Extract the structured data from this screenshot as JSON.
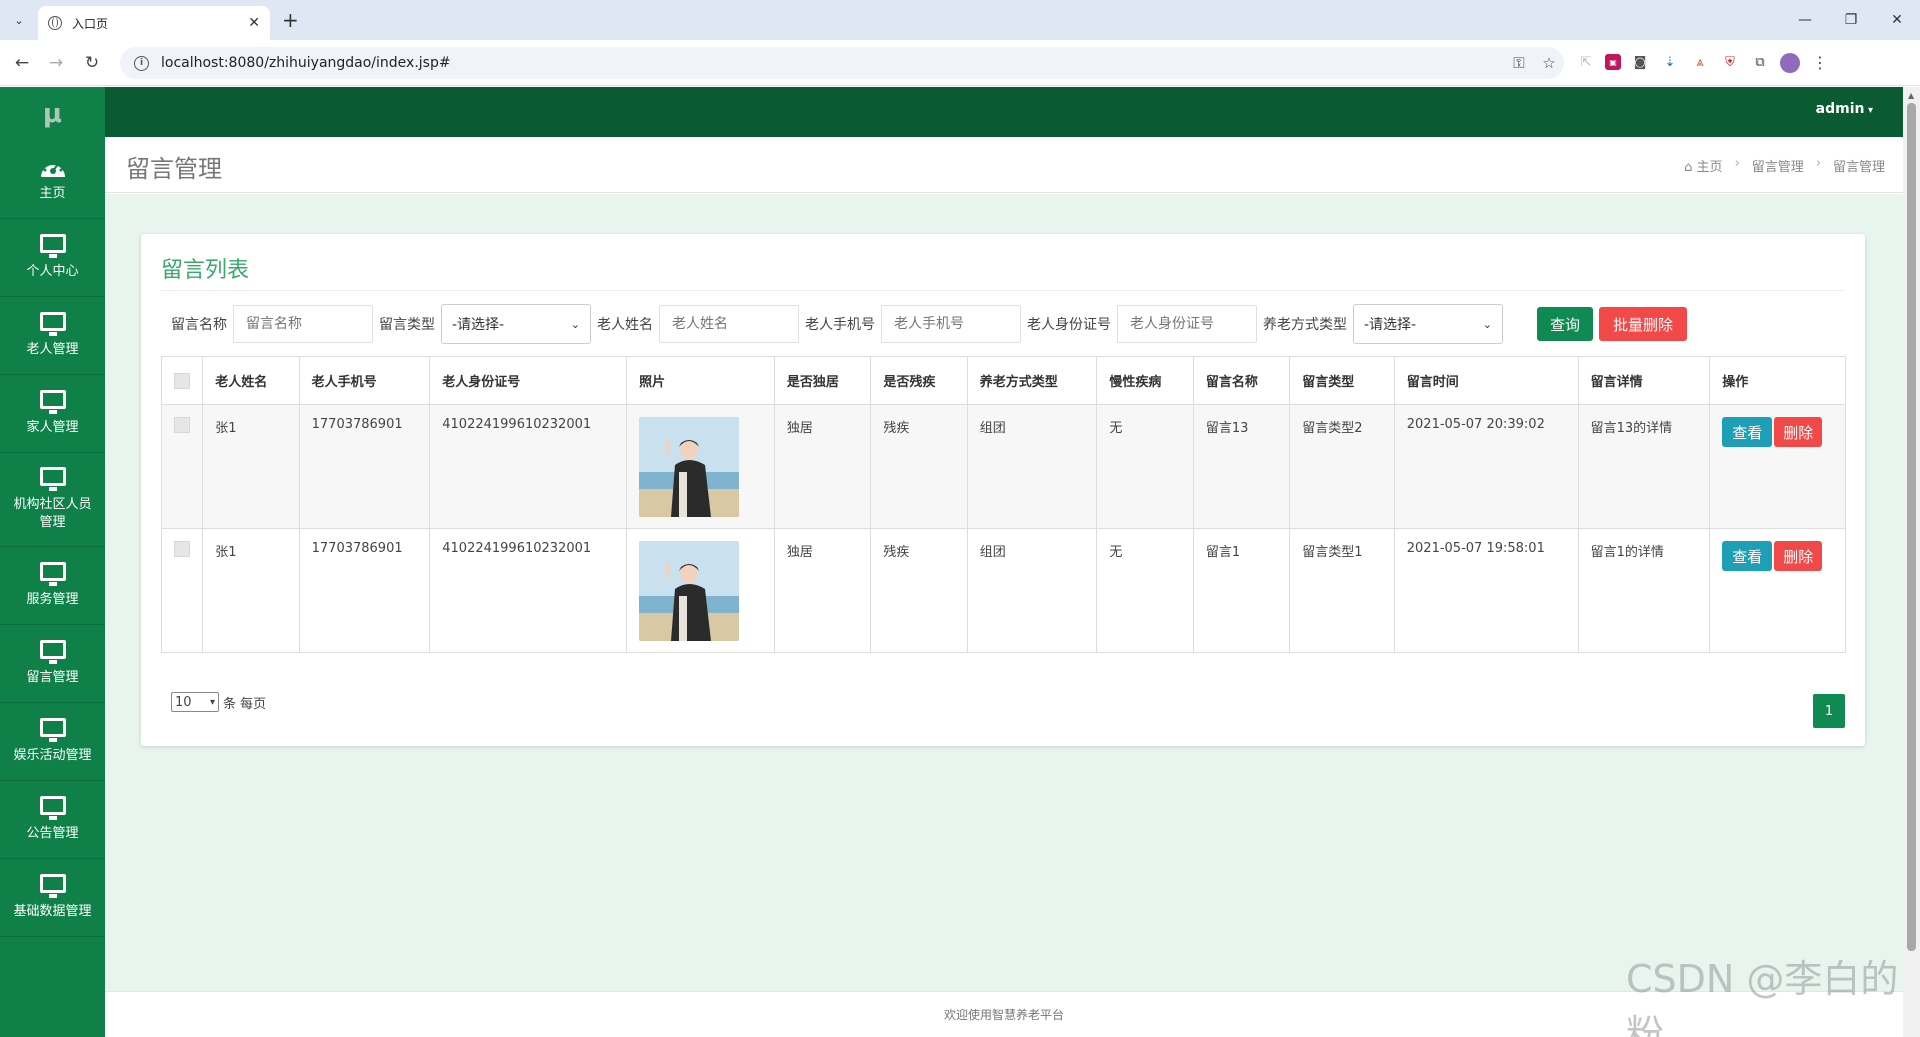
{
  "browser": {
    "tab_title": "入口页",
    "url": "localhost:8080/zhihuiyangdao/index.jsp#"
  },
  "sidebar": {
    "logo": "μ",
    "items": [
      {
        "label": "主页",
        "icon": "dashboard-icon"
      },
      {
        "label": "个人中心",
        "icon": "monitor-icon"
      },
      {
        "label": "老人管理",
        "icon": "monitor-icon"
      },
      {
        "label": "家人管理",
        "icon": "monitor-icon"
      },
      {
        "label": "机构社区人员管理",
        "icon": "monitor-icon"
      },
      {
        "label": "服务管理",
        "icon": "monitor-icon"
      },
      {
        "label": "留言管理",
        "icon": "monitor-icon"
      },
      {
        "label": "娱乐活动管理",
        "icon": "monitor-icon"
      },
      {
        "label": "公告管理",
        "icon": "monitor-icon"
      },
      {
        "label": "基础数据管理",
        "icon": "monitor-icon"
      }
    ]
  },
  "topbar": {
    "user": "admin"
  },
  "header": {
    "title": "留言管理",
    "breadcrumb": [
      "主页",
      "留言管理",
      "留言管理"
    ]
  },
  "card": {
    "title": "留言列表"
  },
  "filters": {
    "msg_name_label": "留言名称",
    "msg_name_placeholder": "留言名称",
    "msg_type_label": "留言类型",
    "msg_type_value": "-请选择-",
    "elder_name_label": "老人姓名",
    "elder_name_placeholder": "老人姓名",
    "elder_phone_label": "老人手机号",
    "elder_phone_placeholder": "老人手机号",
    "elder_id_label": "老人身份证号",
    "elder_id_placeholder": "老人身份证号",
    "care_type_label": "养老方式类型",
    "care_type_value": "-请选择-",
    "search_label": "查询",
    "batch_delete_label": "批量删除"
  },
  "table": {
    "headers": [
      "老人姓名",
      "老人手机号",
      "老人身份证号",
      "照片",
      "是否独居",
      "是否残疾",
      "养老方式类型",
      "慢性疾病",
      "留言名称",
      "留言类型",
      "留言时间",
      "留言详情",
      "操作"
    ],
    "rows": [
      {
        "name": "张1",
        "phone": "17703786901",
        "idcard": "410224199610232001",
        "alone": "独居",
        "disabled": "残疾",
        "care_type": "组团",
        "chronic": "无",
        "msg_name": "留言13",
        "msg_type": "留言类型2",
        "time": "2021-05-07 20:39:02",
        "detail": "留言13的详情",
        "view": "查看",
        "del": "删除"
      },
      {
        "name": "张1",
        "phone": "17703786901",
        "idcard": "410224199610232001",
        "alone": "独居",
        "disabled": "残疾",
        "care_type": "组团",
        "chronic": "无",
        "msg_name": "留言1",
        "msg_type": "留言类型1",
        "time": "2021-05-07 19:58:01",
        "detail": "留言1的详情",
        "view": "查看",
        "del": "删除"
      }
    ]
  },
  "pager": {
    "page_size": "10",
    "per_page_label": "条 每页",
    "current_page": "1"
  },
  "footer": {
    "text": "欢迎使用智慧养老平台"
  },
  "watermark": "CSDN @李白的粉",
  "colors": {
    "sidebar": "#0e8048",
    "topbar": "#0a5a32",
    "accent_green": "#0f8a52",
    "danger": "#f14848",
    "info": "#1f9fb6"
  }
}
